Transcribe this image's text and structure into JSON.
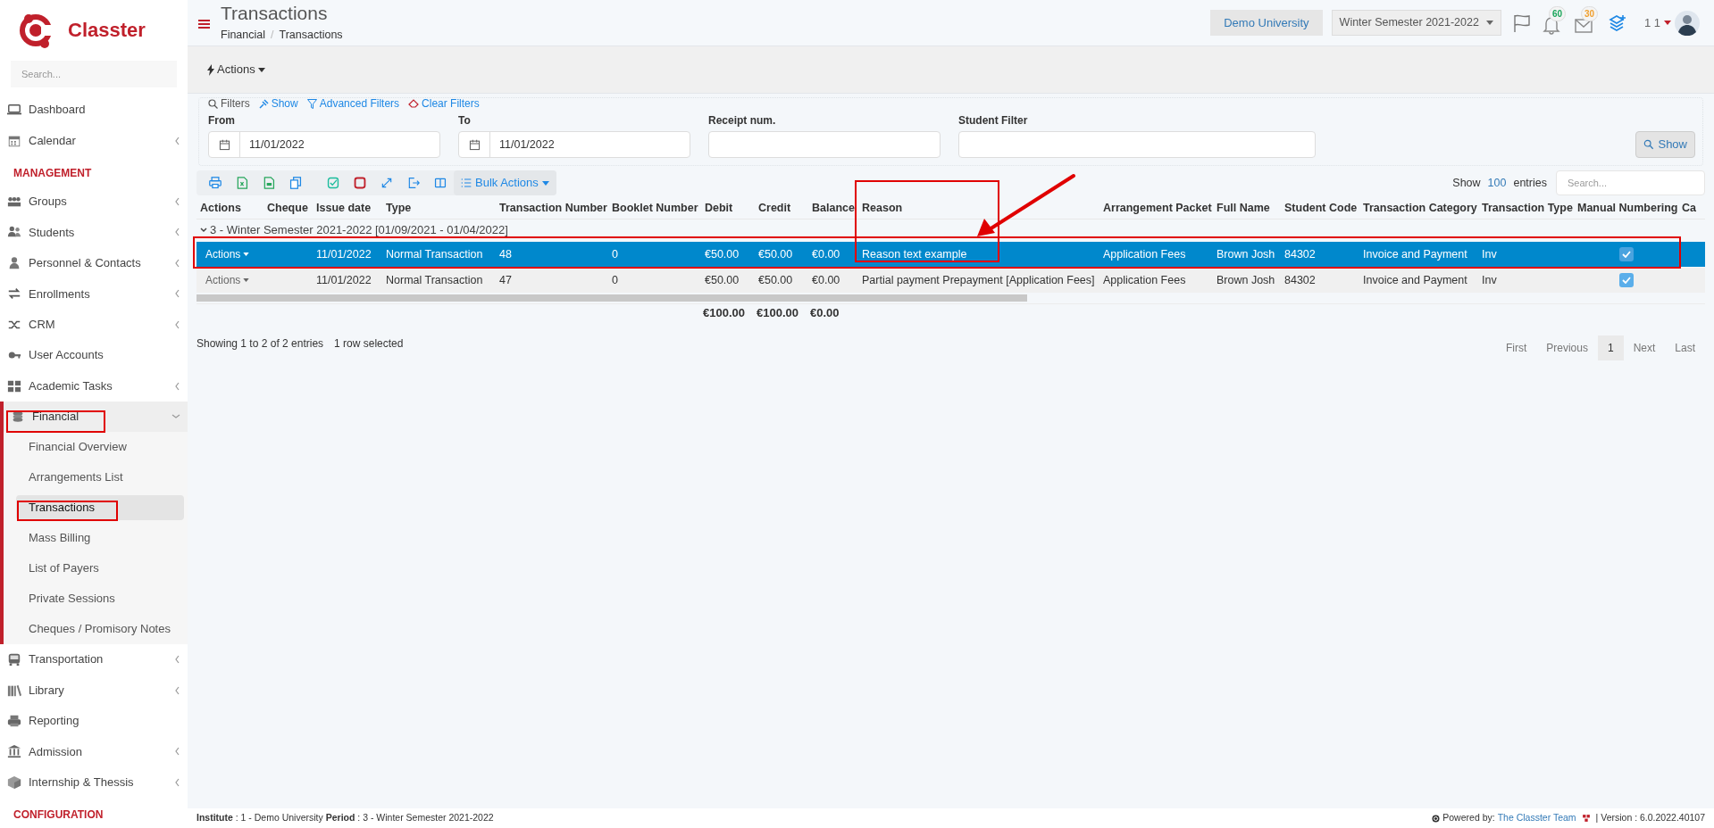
{
  "sidebar": {
    "brand": "Classter",
    "search": {
      "placeholder": "Search..."
    },
    "items": [
      {
        "kind": "item",
        "label": "Dashboard"
      },
      {
        "kind": "group",
        "label": "Calendar",
        "expanded": false
      },
      {
        "kind": "section",
        "label": "MANAGEMENT"
      },
      {
        "kind": "group",
        "label": "Groups",
        "expanded": false
      },
      {
        "kind": "group",
        "label": "Students",
        "expanded": false
      },
      {
        "kind": "group",
        "label": "Personnel & Contacts",
        "expanded": false
      },
      {
        "kind": "group",
        "label": "Enrollments",
        "expanded": false
      },
      {
        "kind": "group",
        "label": "CRM",
        "expanded": false
      },
      {
        "kind": "item",
        "label": "User Accounts"
      },
      {
        "kind": "group",
        "label": "Academic Tasks",
        "expanded": false
      },
      {
        "kind": "group",
        "label": "Financial",
        "expanded": true,
        "children": [
          {
            "label": "Financial Overview",
            "selected": false
          },
          {
            "label": "Arrangements List",
            "selected": false
          },
          {
            "label": "Transactions",
            "selected": true
          },
          {
            "label": "Mass Billing",
            "selected": false
          },
          {
            "label": "List of Payers",
            "selected": false
          },
          {
            "label": "Private Sessions",
            "selected": false
          },
          {
            "label": "Cheques / Promisory Notes",
            "selected": false
          }
        ]
      },
      {
        "kind": "group",
        "label": "Transportation",
        "expanded": false
      },
      {
        "kind": "group",
        "label": "Library",
        "expanded": false
      },
      {
        "kind": "item",
        "label": "Reporting"
      },
      {
        "kind": "group",
        "label": "Admission",
        "expanded": false
      },
      {
        "kind": "group",
        "label": "Internship & Thessis",
        "expanded": false
      },
      {
        "kind": "section",
        "label": "CONFIGURATION"
      }
    ]
  },
  "header": {
    "title": "Transactions",
    "breadcrumb": [
      "Financial",
      "Transactions"
    ],
    "breadcrumb_separator": "/",
    "institution": "Demo University",
    "period": "Winter Semester 2021-2022",
    "notifications": "60",
    "messages": "30",
    "user": "1 1"
  },
  "actions_menu": "Actions",
  "filters": {
    "label": "Filters",
    "links": [
      "Show",
      "Advanced Filters",
      "Clear Filters"
    ],
    "fields": [
      {
        "kind": "date",
        "label": "From",
        "value": "11/01/2022"
      },
      {
        "kind": "date",
        "label": "To",
        "value": "11/01/2022"
      },
      {
        "kind": "text",
        "label": "Receipt num."
      },
      {
        "kind": "text",
        "label": "Student Filter"
      }
    ],
    "submit": "Show"
  },
  "toolbar": {
    "bulk_actions": "Bulk Actions"
  },
  "length": {
    "prefix": "Show",
    "value": "100",
    "suffix": "entries"
  },
  "table_search": {
    "placeholder": "Search..."
  },
  "table": {
    "columns": [
      "Actions",
      "Cheque",
      "Issue date",
      "Type",
      "Transaction Number",
      "Booklet Number",
      "Debit",
      "Credit",
      "Balance",
      "Reason",
      "Arrangement Packet",
      "Full Name",
      "Student Code",
      "Transaction Category",
      "Transaction Type",
      "Manual Numbering",
      "Ca"
    ],
    "group_row": {
      "label": "3 - Winter Semester 2021-2022 [01/09/2021 - 01/04/2022]",
      "expanded": true
    },
    "rows": [
      {
        "selected": true,
        "actions": "Actions",
        "issue_date": "11/01/2022",
        "type": "Normal Transaction",
        "transaction_number": "48",
        "booklet_number": "0",
        "debit": "€50.00",
        "credit": "€50.00",
        "balance": "€0.00",
        "reason": "Reason text example",
        "arrangement_packet": "Application Fees",
        "full_name": "Brown Josh",
        "student_code": "84302",
        "transaction_category": "Invoice and Payment",
        "transaction_type": "Inv",
        "manual_numbering": true
      },
      {
        "selected": false,
        "actions": "Actions",
        "issue_date": "11/01/2022",
        "type": "Normal Transaction",
        "transaction_number": "47",
        "booklet_number": "0",
        "debit": "€50.00",
        "credit": "€50.00",
        "balance": "€0.00",
        "reason": "Partial payment Prepayment [Application Fees]",
        "arrangement_packet": "Application Fees",
        "full_name": "Brown Josh",
        "student_code": "84302",
        "transaction_category": "Invoice and Payment",
        "transaction_type": "Inv",
        "manual_numbering": true
      }
    ],
    "totals": {
      "debit": "€100.00",
      "credit": "€100.00",
      "balance": "€0.00"
    }
  },
  "info": "Showing 1 to 2 of 2 entries",
  "selection_info": "1 row selected",
  "pagination": [
    {
      "label": "First",
      "selected": false
    },
    {
      "label": "Previous",
      "selected": false
    },
    {
      "label": "1",
      "selected": true
    },
    {
      "label": "Next",
      "selected": false
    },
    {
      "label": "Last",
      "selected": false
    }
  ],
  "footer": {
    "context": "**Institute** : 1 - Demo University **Period** : 3 - Winter Semester 2021-2022",
    "powered_by": "Powered by:",
    "team": "The Classter Team",
    "version": "| Version : 6.0.2022.40107"
  }
}
